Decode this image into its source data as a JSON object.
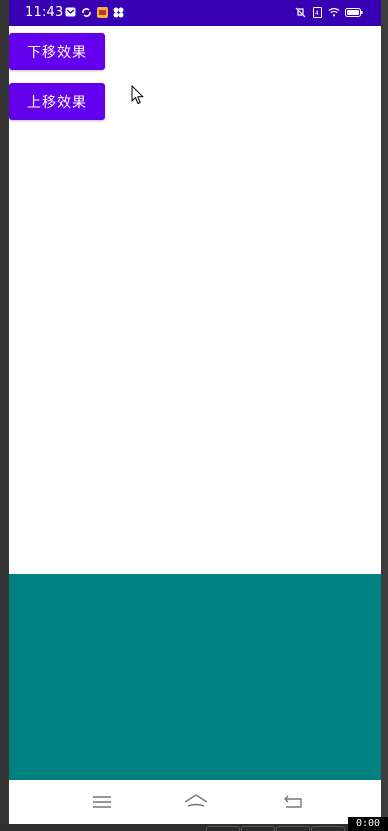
{
  "status_bar": {
    "time": "11:43",
    "left_icons": [
      "mail-icon",
      "sync-icon",
      "app-badge-icon",
      "flower-icon"
    ],
    "right_icons": [
      "mute-icon",
      "battery-saver-icon",
      "wifi-icon",
      "battery-icon"
    ],
    "background": "#3700b3"
  },
  "main": {
    "buttons": [
      {
        "label": "下移效果"
      },
      {
        "label": "上移效果"
      }
    ],
    "accent": "#6200ee",
    "panel_color": "#008080"
  },
  "nav_bar": {
    "icons": [
      "menu-icon",
      "home-icon",
      "back-icon"
    ]
  },
  "recorder": {
    "timer": "0:00"
  }
}
